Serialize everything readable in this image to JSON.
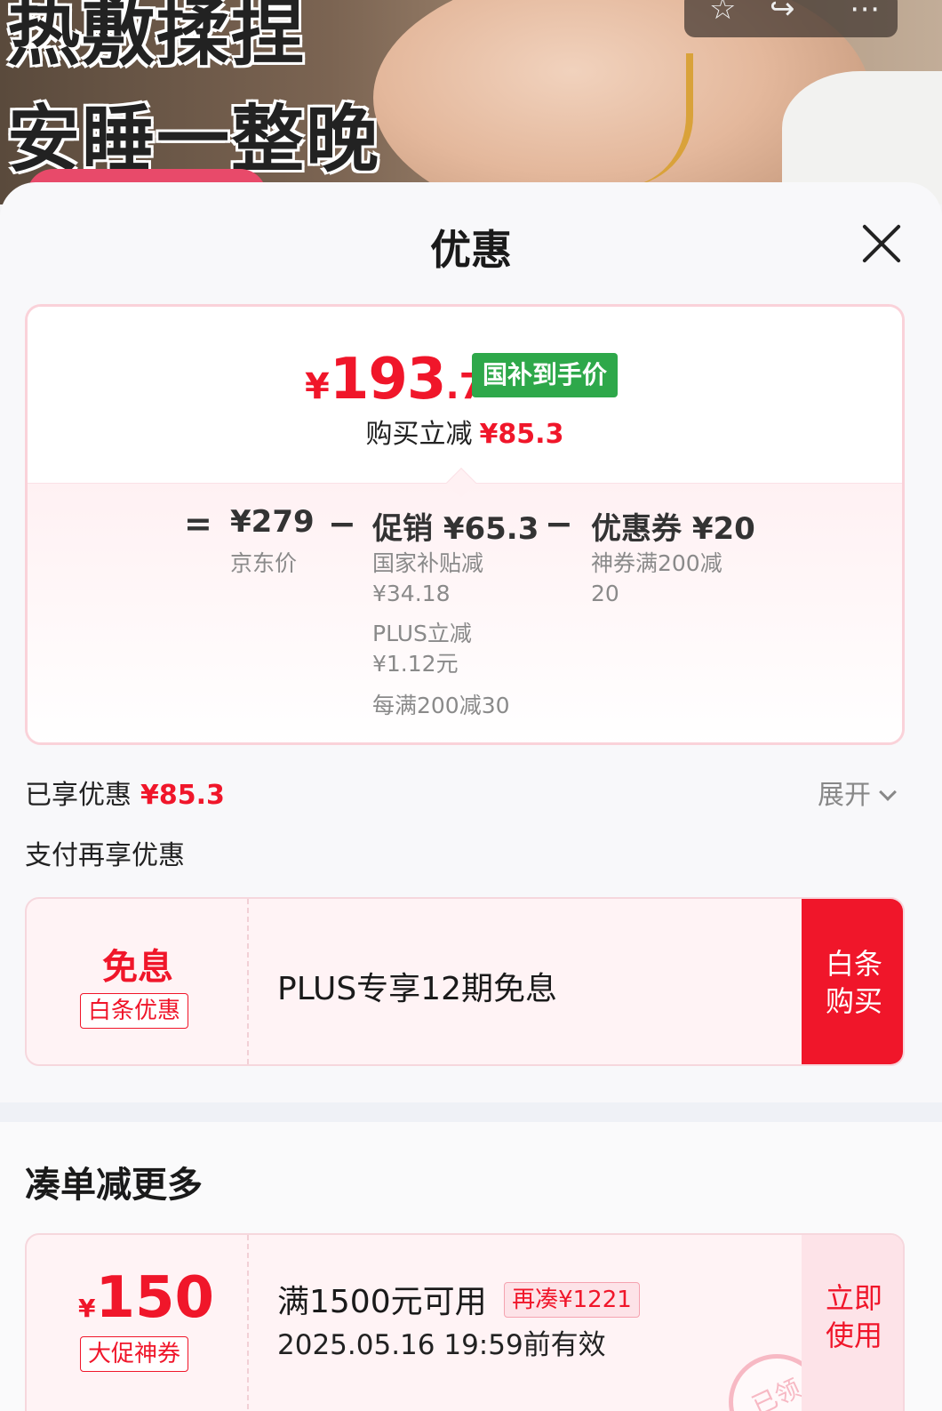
{
  "hero": {
    "line1": "热敷揉捏",
    "line2": "安睡一整晚"
  },
  "sheet": {
    "title": "优惠"
  },
  "price": {
    "currency": "¥",
    "integer": "193",
    "decimal": ".7",
    "tag": "国补到手价",
    "save_label": "购买立减",
    "save_amount": "¥85.3"
  },
  "breakdown": {
    "equals": "=",
    "jd_price": "¥279",
    "jd_label": "京东价",
    "minus": "−",
    "promo_main": "促销 ¥65.3",
    "promo_sub1_a": "国家补贴减",
    "promo_sub1_b": "¥34.18",
    "promo_sub2_a": "PLUS立减",
    "promo_sub2_b": "¥1.12元",
    "promo_sub3": "每满200减30",
    "coupon_main": "优惠券 ¥20",
    "coupon_sub_a": "神券满200减",
    "coupon_sub_b": "20"
  },
  "enjoyed": {
    "label": "已享优惠",
    "amount": "¥85.3",
    "expand": "展开"
  },
  "pay_more": {
    "label": "支付再享优惠"
  },
  "baitiao_coupon": {
    "title": "免息",
    "tag": "白条优惠",
    "desc": "PLUS专享12期免息",
    "action_line1": "白条",
    "action_line2": "购买"
  },
  "more": {
    "title": "凑单减更多"
  },
  "promo_coupon": {
    "currency": "¥",
    "amount": "150",
    "tag": "大促神券",
    "condition": "满1500元可用",
    "remain_tag": "再凑¥1221",
    "validity": "2025.05.16 19:59前有效",
    "action_line1": "立即",
    "action_line2": "使用",
    "stamp": "已领"
  },
  "colors": {
    "accent_red": "#f0162a",
    "green_tag": "#2ea84a",
    "card_border": "#fad2d9"
  }
}
